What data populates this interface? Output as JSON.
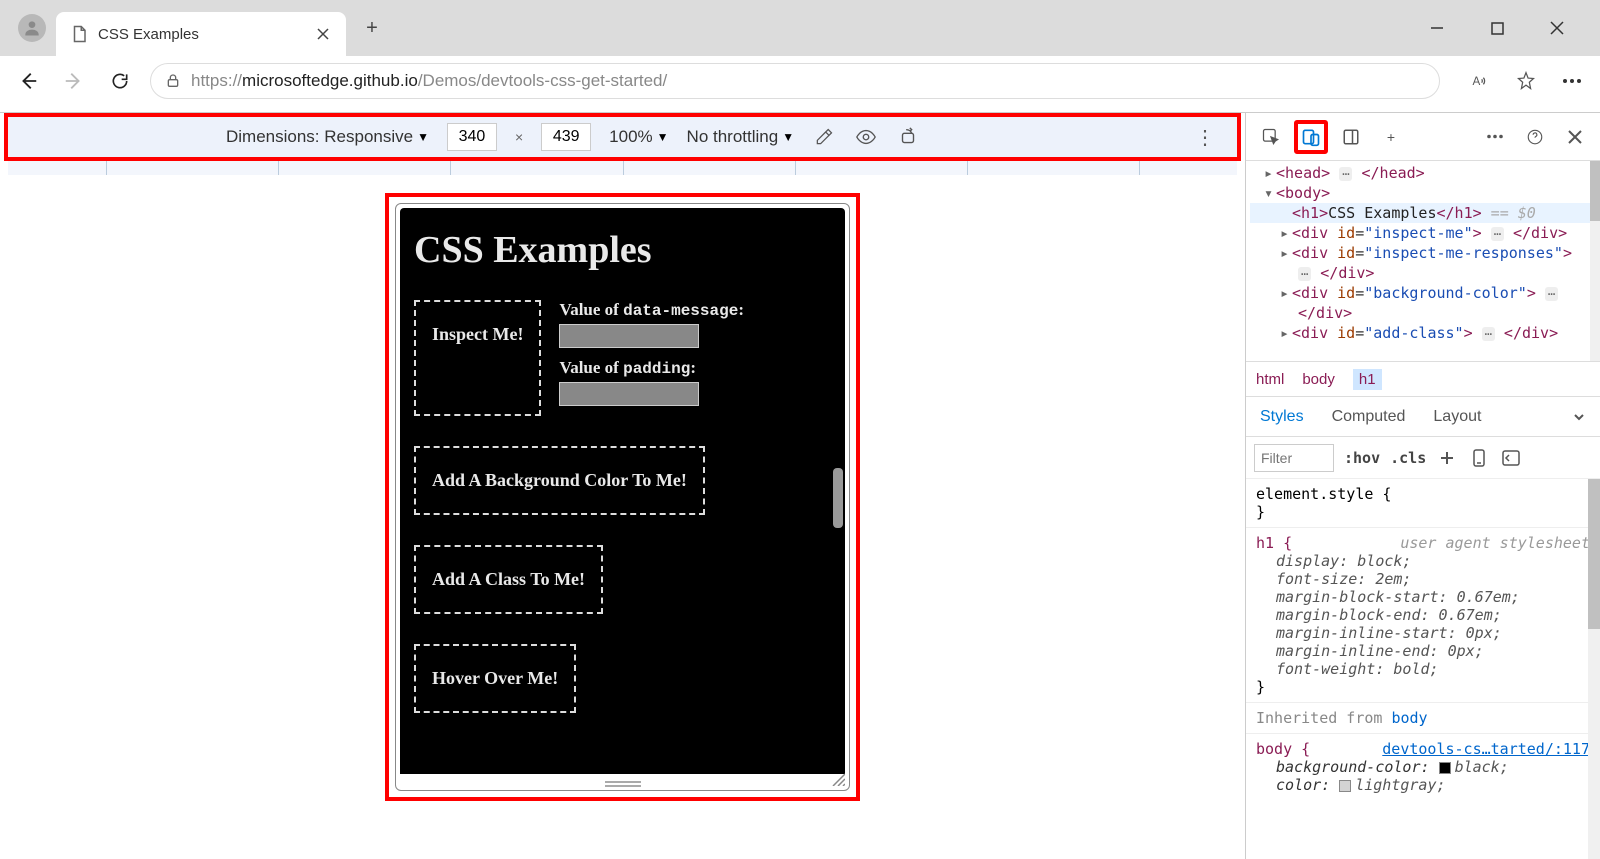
{
  "browser": {
    "tab_title": "CSS Examples",
    "url_prefix": "https://",
    "url_host": "microsoftedge.github.io",
    "url_path": "/Demos/devtools-css-get-started/"
  },
  "device_toolbar": {
    "dimensions_label": "Dimensions: Responsive",
    "width": "340",
    "height": "439",
    "zoom": "100%",
    "throttling": "No throttling"
  },
  "page": {
    "h1": "CSS Examples",
    "inspect_me": "Inspect Me!",
    "value_data_message_label": "Value of ",
    "value_data_message_code": "data-message",
    "value_padding_label": "Value of ",
    "value_padding_code": "padding",
    "bg_color": "Add A Background Color To Me!",
    "add_class": "Add A Class To Me!",
    "hover": "Hover Over Me!"
  },
  "elements": {
    "head_open": "<head>",
    "head_close": "</head>",
    "body_open": "<body>",
    "h1_open": "<h1>",
    "h1_text": "CSS Examples",
    "h1_close": "</h1>",
    "eq0": " == $0",
    "div1_open": "<div id=\"inspect-me\">",
    "div_close": "</div>",
    "div2_open": "<div id=\"inspect-me-responses\">",
    "div3_open": "<div id=\"background-color\">",
    "div4_open": "<div id=\"add-class\">"
  },
  "breadcrumb": {
    "a": "html",
    "b": "body",
    "c": "h1"
  },
  "styles_tabs": {
    "styles": "Styles",
    "computed": "Computed",
    "layout": "Layout"
  },
  "filter": {
    "placeholder": "Filter",
    "hov": ":hov",
    "cls": ".cls"
  },
  "styles": {
    "element_style": "element.style {",
    "close": "}",
    "h1_sel": "h1 {",
    "ua_sheet": "user agent stylesheet",
    "p_display": "display: block;",
    "p_fontsize": "font-size: 2em;",
    "p_mbs": "margin-block-start: 0.67em;",
    "p_mbe": "margin-block-end: 0.67em;",
    "p_mis": "margin-inline-start: 0px;",
    "p_mie": "margin-inline-end: 0px;",
    "p_fw": "font-weight: bold;",
    "inherited": "Inherited from ",
    "inherited_body": "body",
    "body_sel": "body {",
    "body_src": "devtools-cs…tarted/:117",
    "p_bg_name": "background-color: ",
    "p_bg_val": "black;",
    "p_color_name": "color: ",
    "p_color_val": "lightgray;"
  }
}
